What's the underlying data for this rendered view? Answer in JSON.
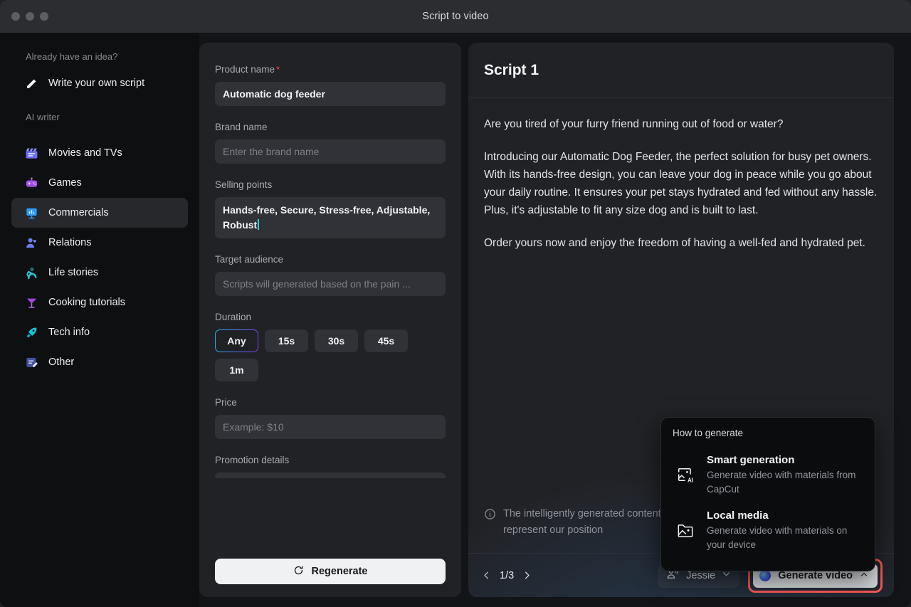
{
  "window": {
    "title": "Script to video",
    "traffic_lights": [
      "close",
      "minimize",
      "maximize"
    ]
  },
  "sidebar": {
    "idea_heading": "Already have an idea?",
    "write_own": {
      "label": "Write your own script",
      "icon": "pencil-icon"
    },
    "ai_heading": "AI writer",
    "items": [
      {
        "label": "Movies and TVs",
        "icon": "clapperboard-icon",
        "color": "#6b6ef5",
        "active": false
      },
      {
        "label": "Games",
        "icon": "gamepad-icon",
        "color": "#a24ff0",
        "active": false
      },
      {
        "label": "Commercials",
        "icon": "presentation-icon",
        "color": "#2b9cf7",
        "active": true
      },
      {
        "label": "Relations",
        "icon": "person-heart-icon",
        "color": "#6b7bf0",
        "active": false
      },
      {
        "label": "Life stories",
        "icon": "person-wave-icon",
        "color": "#21b2b8",
        "active": false
      },
      {
        "label": "Cooking tutorials",
        "icon": "cocktail-icon",
        "color": "#9b4be0",
        "active": false
      },
      {
        "label": "Tech info",
        "icon": "rocket-tag-icon",
        "color": "#18c6d8",
        "active": false
      },
      {
        "label": "Other",
        "icon": "note-edit-icon",
        "color": "#5b6fd6",
        "active": false
      }
    ]
  },
  "form": {
    "product_name": {
      "label": "Product name",
      "required_mark": "*",
      "value": "Automatic dog feeder"
    },
    "brand_name": {
      "label": "Brand name",
      "value": "",
      "placeholder": "Enter the brand name"
    },
    "selling_points": {
      "label": "Selling points",
      "value": "Hands-free, Secure, Stress-free, Adjustable, Robust"
    },
    "target_audience": {
      "label": "Target audience",
      "value": "",
      "placeholder": "Scripts will generated based on the pain ..."
    },
    "duration": {
      "label": "Duration",
      "options": [
        "Any",
        "15s",
        "30s",
        "45s",
        "1m"
      ],
      "selected": "Any"
    },
    "price": {
      "label": "Price",
      "value": "",
      "placeholder": "Example: $10"
    },
    "promotion_details": {
      "label": "Promotion details"
    },
    "regenerate": {
      "label": "Regenerate",
      "icon": "refresh-icon"
    }
  },
  "script": {
    "title": "Script 1",
    "paragraphs": [
      "Are you tired of your furry friend running out of food or water?",
      "Introducing our Automatic Dog Feeder, the perfect solution for busy pet owners. With its hands-free design, you can leave your dog in peace while you go about your daily routine. It ensures your pet stays hydrated and fed without any hassle. Plus, it's adjustable to fit any size dog and is built to last.",
      "Order yours now and enjoy the freedom of having a well-fed and hydrated pet."
    ],
    "disclaimer": "The intelligently generated content is for reference purposes only and does not represent our position",
    "disclaimer_icon": "info-icon",
    "pagination": {
      "prev_icon": "chevron-left-icon",
      "index": "1/3",
      "next_icon": "chevron-right-icon"
    },
    "voice": {
      "name": "Jessie",
      "icon": "voice-person-icon",
      "chevron": "chevron-down-icon"
    },
    "generate": {
      "label": "Generate video",
      "icon": "ai-orb-icon",
      "chevron": "chevron-up-icon",
      "highlight_color": "#fc5a57"
    }
  },
  "popover": {
    "title": "How to generate",
    "items": [
      {
        "name": "Smart generation",
        "desc": "Generate video with materials from CapCut",
        "icon": "ai-frame-icon"
      },
      {
        "name": "Local media",
        "desc": "Generate video with materials on your device",
        "icon": "folder-image-icon"
      }
    ]
  }
}
